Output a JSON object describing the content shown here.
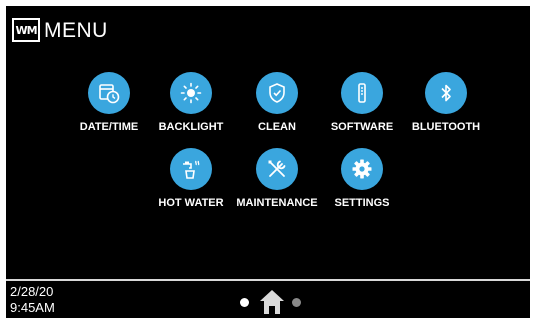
{
  "header": {
    "logo_text": "WM",
    "title": "MENU"
  },
  "menu": {
    "items": [
      {
        "label": "DATE/TIME",
        "icon": "calendar-clock-icon"
      },
      {
        "label": "BACKLIGHT",
        "icon": "brightness-icon"
      },
      {
        "label": "CLEAN",
        "icon": "clean-shield-icon"
      },
      {
        "label": "SOFTWARE",
        "icon": "software-icon"
      },
      {
        "label": "BLUETOOTH",
        "icon": "bluetooth-icon"
      },
      {
        "label": "HOT WATER",
        "icon": "hot-water-icon"
      },
      {
        "label": "MAINTENANCE",
        "icon": "tools-icon"
      },
      {
        "label": "SETTINGS",
        "icon": "gear-icon"
      }
    ]
  },
  "footer": {
    "date": "2/28/20",
    "time": "9:45AM",
    "page_count": 2,
    "active_page": 1,
    "home_icon": "home-icon"
  },
  "colors": {
    "background": "#000000",
    "icon_circle": "#3aa6de",
    "text": "#ffffff",
    "divider": "#d8d8d8",
    "inactive_dot": "#8a8a8a"
  }
}
